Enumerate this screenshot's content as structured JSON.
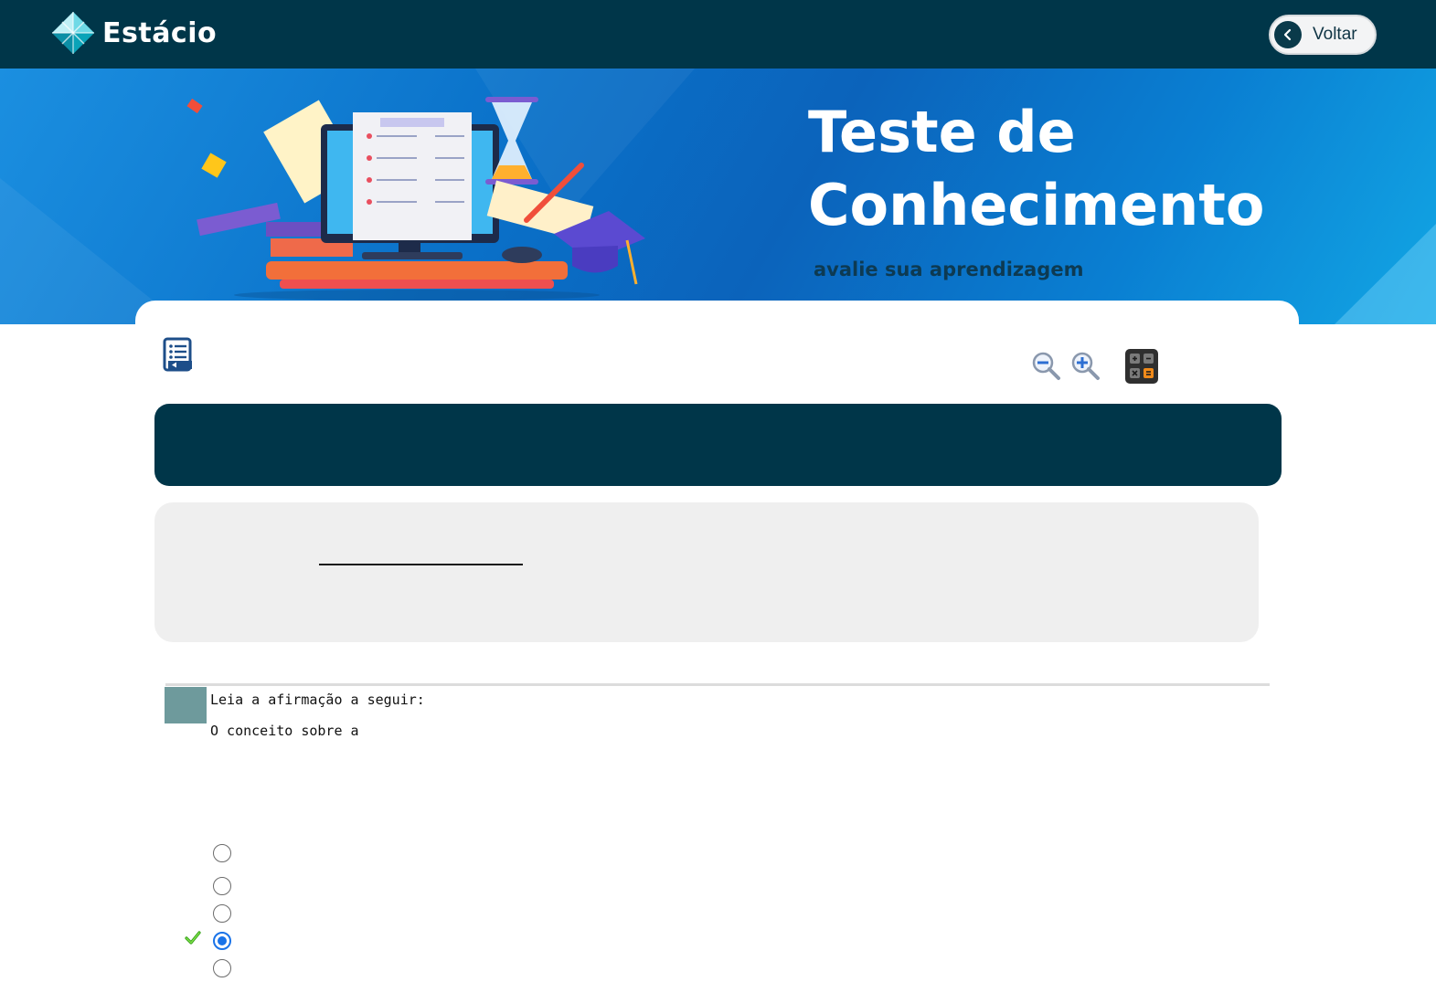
{
  "app": {
    "brand_name": "Estácio",
    "back_label": "Voltar"
  },
  "banner": {
    "title_line1": "Teste de",
    "title_line2": "Conhecimento",
    "subtitle": "avalie sua aprendizagem"
  },
  "toolbar": {
    "list_icon": "question-list-icon",
    "zoom_out_icon": "zoom-out-icon",
    "zoom_in_icon": "zoom-in-icon",
    "calculator_icon": "calculator-icon"
  },
  "question": {
    "line1": "Leia a afirmação a seguir:",
    "line2": "O conceito sobre a",
    "options": [
      {
        "selected": false,
        "correct": false
      },
      {
        "selected": false,
        "correct": false
      },
      {
        "selected": false,
        "correct": false
      },
      {
        "selected": true,
        "correct": true
      },
      {
        "selected": false,
        "correct": false
      }
    ]
  },
  "colors": {
    "navbar": "#003649",
    "banner_blue": "#0a71c9",
    "question_header": "#003649",
    "info_box": "#efefef",
    "question_number_box": "#6e9a9c",
    "radio_selected": "#1a73e8",
    "correct_check": "#3cb81a"
  }
}
